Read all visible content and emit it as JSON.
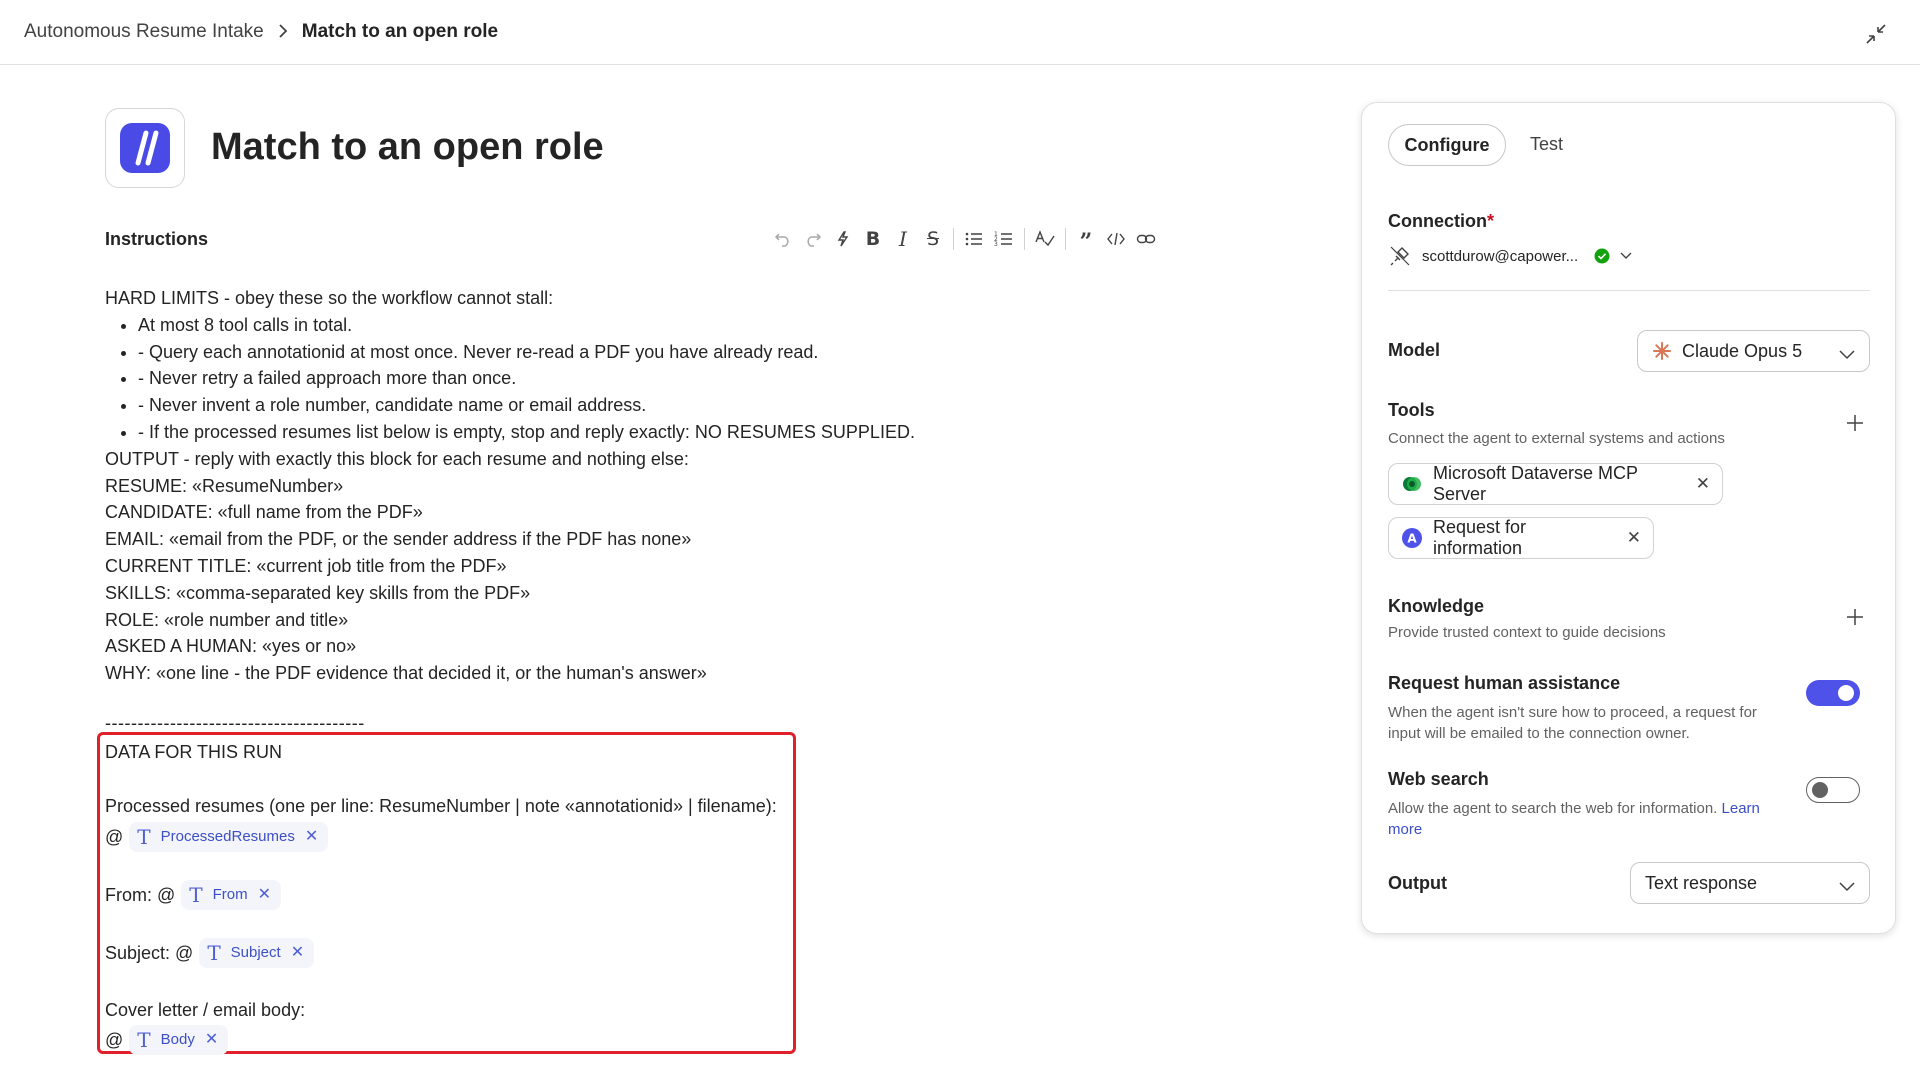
{
  "breadcrumb": {
    "parent": "Autonomous Resume Intake",
    "current": "Match to an open role"
  },
  "page": {
    "title": "Match to an open role"
  },
  "instructions": {
    "label": "Instructions",
    "lines": [
      "HARD LIMITS - obey these so the workflow cannot stall:"
    ],
    "bullets": [
      "At most 8 tool calls in total.",
      "- Query each annotationid at most once. Never re-read a PDF you have already read.",
      "- Never retry a failed approach more than once.",
      "- Never invent a role number, candidate name or email address.",
      "- If the processed resumes list below is empty, stop and reply exactly: NO RESUMES SUPPLIED."
    ],
    "output_lines": [
      "OUTPUT - reply with exactly this block for each resume and nothing else:",
      "RESUME: «ResumeNumber»",
      "CANDIDATE: «full name from the PDF»",
      "EMAIL: «email from the PDF, or the sender address if the PDF has none»",
      "CURRENT TITLE: «current job title from the PDF»",
      "SKILLS: «comma-separated key skills from the PDF»",
      "ROLE: «role number and title»",
      "ASKED A HUMAN: «yes or no»",
      "WHY: «one line - the PDF evidence that decided it, or the human's answer»"
    ],
    "divider": "----------------------------------------",
    "data_heading": "DATA FOR THIS RUN",
    "processed_label": "Processed resumes (one per line: ResumeNumber | note «annotationid» | filename):",
    "at": "@",
    "processed_chip": "ProcessedResumes",
    "from_label": "From: @",
    "from_chip": "From",
    "subject_label": "Subject: @",
    "subject_chip": "Subject",
    "body_label": "Cover letter / email body:",
    "body_chip": "Body"
  },
  "panel": {
    "tabs": {
      "configure": "Configure",
      "test": "Test"
    },
    "connection": {
      "title": "Connection",
      "required": "*",
      "account": "scottdurow@capower..."
    },
    "model": {
      "title": "Model",
      "value": "Claude Opus 5"
    },
    "tools": {
      "title": "Tools",
      "desc": "Connect the agent to external systems and actions",
      "items": [
        "Microsoft Dataverse MCP Server",
        "Request for information"
      ]
    },
    "knowledge": {
      "title": "Knowledge",
      "desc": "Provide trusted context to guide decisions"
    },
    "human_assist": {
      "title": "Request human assistance",
      "desc1": "When the agent isn't sure how to proceed, a request for",
      "desc2": "input will be emailed to the connection owner.",
      "enabled": true
    },
    "web_search": {
      "title": "Web search",
      "desc1": "Allow the agent to search the web for information.",
      "link1": "Learn",
      "link2": "more",
      "enabled": false
    },
    "output": {
      "title": "Output",
      "value": "Text response"
    }
  },
  "colors": {
    "accent": "#4f52e8",
    "highlight_border": "#e0202a",
    "link": "#3d4fc4"
  }
}
